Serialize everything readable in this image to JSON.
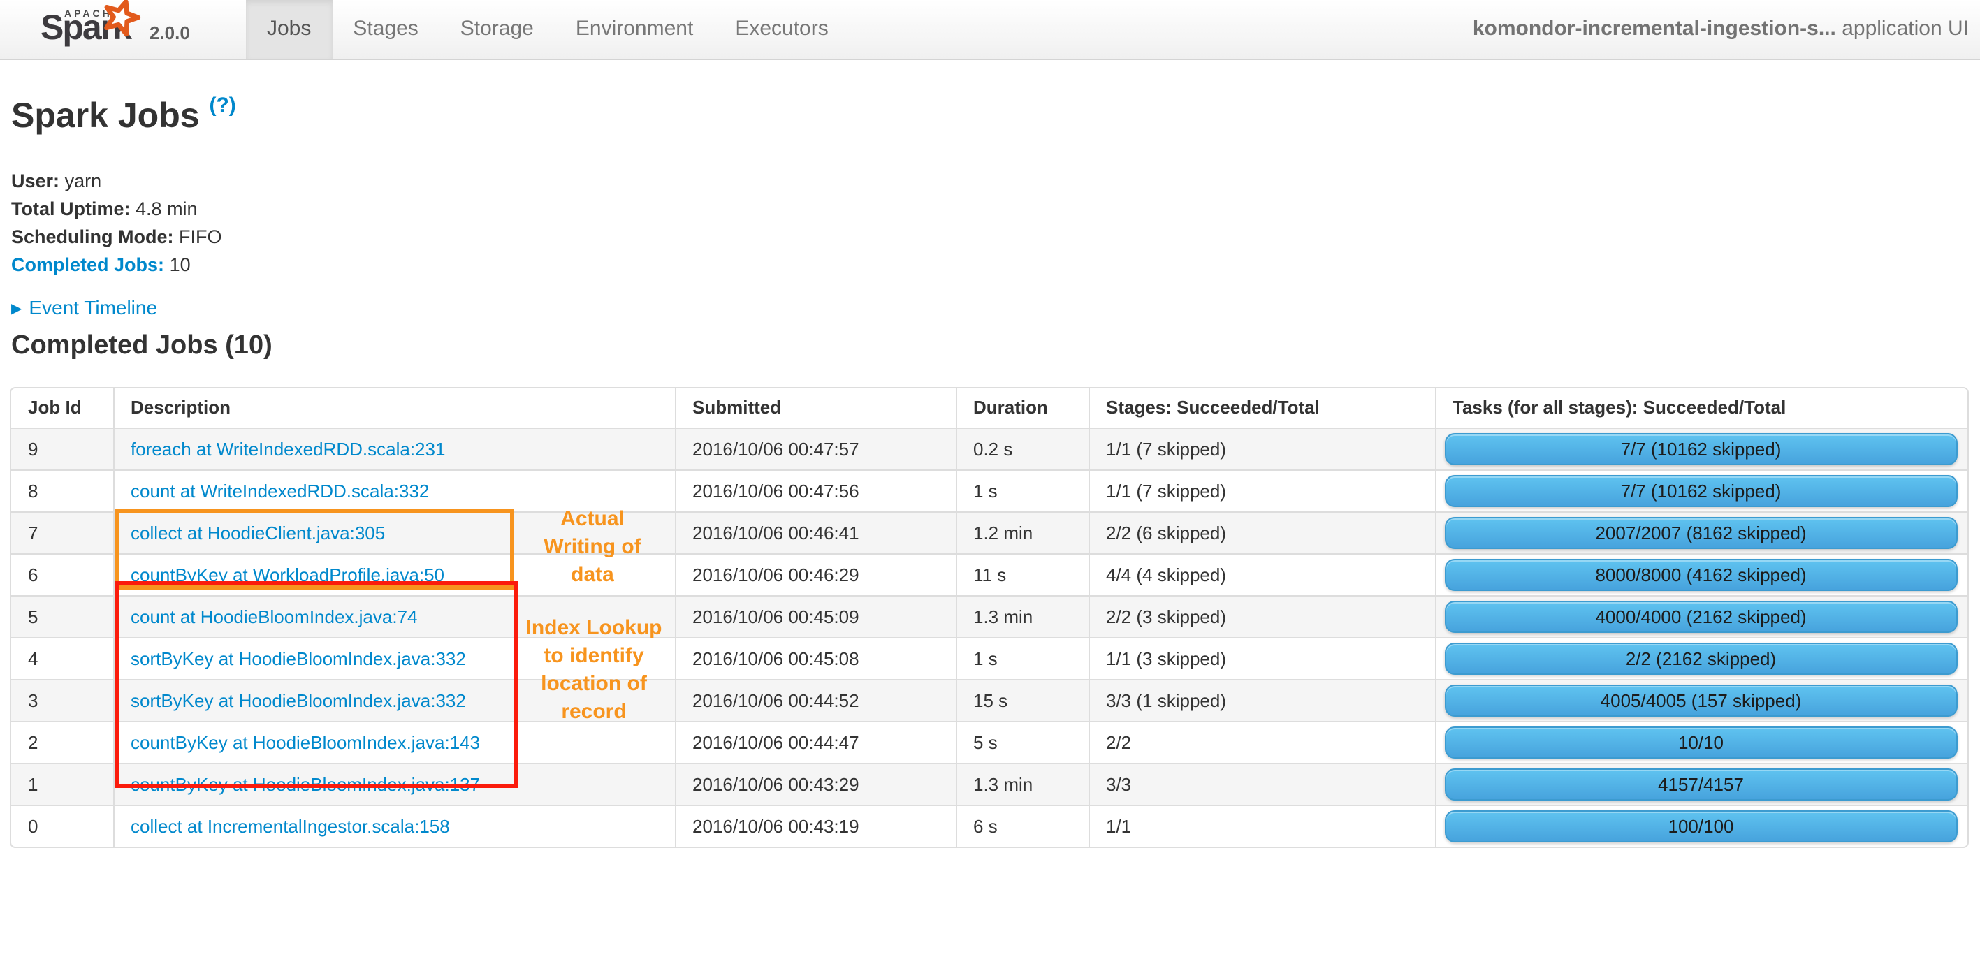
{
  "navbar": {
    "brand": {
      "apache": "APACHE",
      "name": "Spark",
      "version": "2.0.0"
    },
    "tabs": [
      {
        "label": "Jobs",
        "active": true
      },
      {
        "label": "Stages",
        "active": false
      },
      {
        "label": "Storage",
        "active": false
      },
      {
        "label": "Environment",
        "active": false
      },
      {
        "label": "Executors",
        "active": false
      }
    ],
    "app_name": "komondor-incremental-ingestion-s...",
    "app_suffix": " application UI"
  },
  "page": {
    "title": "Spark Jobs",
    "help_badge": "(?)",
    "info": [
      {
        "label": "User:",
        "value": "yarn"
      },
      {
        "label": "Total Uptime:",
        "value": "4.8 min"
      },
      {
        "label": "Scheduling Mode:",
        "value": "FIFO"
      }
    ],
    "completed_jobs": {
      "label": "Completed Jobs:",
      "value": "10"
    },
    "event_timeline": {
      "arrow": "▶",
      "label": "Event Timeline"
    },
    "section_title": "Completed Jobs (10)"
  },
  "table": {
    "columns": [
      "Job Id",
      "Description",
      "Submitted",
      "Duration",
      "Stages: Succeeded/Total",
      "Tasks (for all stages): Succeeded/Total"
    ],
    "rows": [
      {
        "job_id": "9",
        "description": "foreach at WriteIndexedRDD.scala:231",
        "submitted": "2016/10/06 00:47:57",
        "duration": "0.2 s",
        "stages": "1/1 (7 skipped)",
        "tasks": "7/7 (10162 skipped)",
        "progress_pct": 100
      },
      {
        "job_id": "8",
        "description": "count at WriteIndexedRDD.scala:332",
        "submitted": "2016/10/06 00:47:56",
        "duration": "1 s",
        "stages": "1/1 (7 skipped)",
        "tasks": "7/7 (10162 skipped)",
        "progress_pct": 100
      },
      {
        "job_id": "7",
        "description": "collect at HoodieClient.java:305",
        "submitted": "2016/10/06 00:46:41",
        "duration": "1.2 min",
        "stages": "2/2 (6 skipped)",
        "tasks": "2007/2007 (8162 skipped)",
        "progress_pct": 100
      },
      {
        "job_id": "6",
        "description": "countByKey at WorkloadProfile.java:50",
        "submitted": "2016/10/06 00:46:29",
        "duration": "11 s",
        "stages": "4/4 (4 skipped)",
        "tasks": "8000/8000 (4162 skipped)",
        "progress_pct": 100
      },
      {
        "job_id": "5",
        "description": "count at HoodieBloomIndex.java:74",
        "submitted": "2016/10/06 00:45:09",
        "duration": "1.3 min",
        "stages": "2/2 (3 skipped)",
        "tasks": "4000/4000 (2162 skipped)",
        "progress_pct": 100
      },
      {
        "job_id": "4",
        "description": "sortByKey at HoodieBloomIndex.java:332",
        "submitted": "2016/10/06 00:45:08",
        "duration": "1 s",
        "stages": "1/1 (3 skipped)",
        "tasks": "2/2 (2162 skipped)",
        "progress_pct": 100
      },
      {
        "job_id": "3",
        "description": "sortByKey at HoodieBloomIndex.java:332",
        "submitted": "2016/10/06 00:44:52",
        "duration": "15 s",
        "stages": "3/3 (1 skipped)",
        "tasks": "4005/4005 (157 skipped)",
        "progress_pct": 100
      },
      {
        "job_id": "2",
        "description": "countByKey at HoodieBloomIndex.java:143",
        "submitted": "2016/10/06 00:44:47",
        "duration": "5 s",
        "stages": "2/2",
        "tasks": "10/10",
        "progress_pct": 100
      },
      {
        "job_id": "1",
        "description": "countByKey at HoodieBloomIndex.java:137",
        "submitted": "2016/10/06 00:43:29",
        "duration": "1.3 min",
        "stages": "3/3",
        "tasks": "4157/4157",
        "progress_pct": 100
      },
      {
        "job_id": "0",
        "description": "collect at IncrementalIngestor.scala:158",
        "submitted": "2016/10/06 00:43:19",
        "duration": "6 s",
        "stages": "1/1",
        "tasks": "100/100",
        "progress_pct": 100
      }
    ]
  },
  "annotations": {
    "writing": {
      "lines": [
        "Actual",
        "Writing of",
        "data"
      ]
    },
    "index_lookup": {
      "lines": [
        "Index Lookup",
        "to identify",
        "location of",
        "record"
      ]
    }
  },
  "colors": {
    "link_blue": "#0088cc",
    "annotation_orange": "#f7941e",
    "annotation_red": "#fb1b0c",
    "progress_bar_top": "#5fc3f0",
    "progress_bar_bottom": "#47a3dd",
    "table_border": "#dddddd",
    "row_stripe": "#f5f5f5"
  }
}
